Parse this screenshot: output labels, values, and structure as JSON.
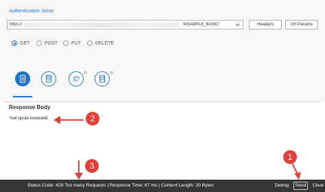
{
  "header": {
    "auth_label": "Authentication: None"
  },
  "url": {
    "prefix": "https://",
    "suffix": "WSAMPLE_BASIC/"
  },
  "buttons": {
    "headers": "Headers",
    "url_params": "Url Params"
  },
  "methods": [
    {
      "label": "GET",
      "selected": true
    },
    {
      "label": "POST",
      "selected": false
    },
    {
      "label": "PUT",
      "selected": false
    },
    {
      "label": "DELETE",
      "selected": false
    }
  ],
  "tabs": [
    {
      "icon": "document-icon",
      "active": true,
      "count": ""
    },
    {
      "icon": "request-doc-icon",
      "active": false,
      "count": ""
    },
    {
      "icon": "cookie-hand-icon",
      "active": false,
      "count": "0"
    },
    {
      "icon": "response-doc-icon",
      "active": false,
      "count": "0"
    }
  ],
  "response": {
    "title": "Response Body",
    "body": "Your quota exceeded"
  },
  "annotations": {
    "one": "1",
    "two": "2",
    "three": "3"
  },
  "status_bar": {
    "status": "Status Code: 429 Too many Requests | Response Time: 67 ms | Content Length: 20 Bytes",
    "debug": "Debug",
    "send": "Send",
    "clear": "Clear"
  },
  "colors": {
    "accent": "#2573c9",
    "callout": "#e0413a",
    "status_bar": "#363636"
  }
}
